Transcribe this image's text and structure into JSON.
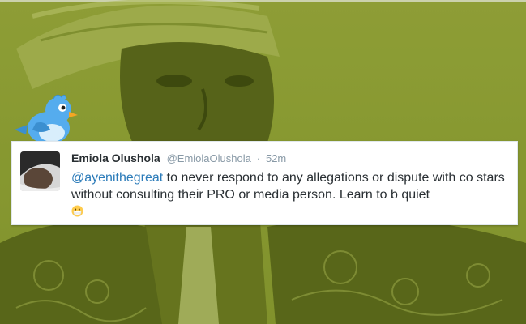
{
  "tweet": {
    "display_name": "Emiola Olushola",
    "handle": "@EmiolaOlushola",
    "separator": "·",
    "time": "52m",
    "mention": "@ayenithegreat",
    "body": " to never respond to any allegations or dispute with co stars without consulting their PRO or media person. Learn to b quiet",
    "emoji": "face-with-medical-mask"
  },
  "colors": {
    "background_tint": "#8f9d3a",
    "mention": "#2b7bb9",
    "text": "#292f33",
    "muted": "#8899a6",
    "bird": "#55acee"
  },
  "icons": [
    "twitter-bird-icon",
    "avatar",
    "medical-mask-emoji-icon"
  ]
}
